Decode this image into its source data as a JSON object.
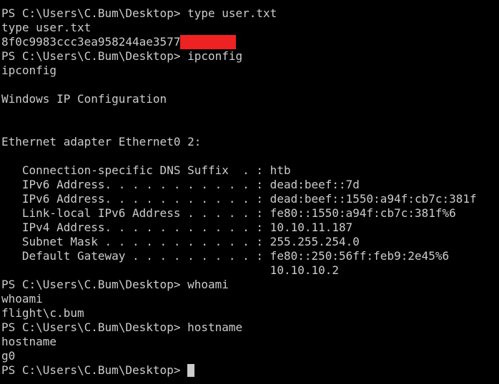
{
  "terminal": {
    "text_color": "#cccccc",
    "background_color": "#000000",
    "redaction_color": "#ee2222",
    "lines": [
      "PS C:\\Users\\C.Bum\\Desktop> type user.txt",
      "type user.txt",
      "8f0c9983ccc3ea958244ae3577",
      "PS C:\\Users\\C.Bum\\Desktop> ipconfig",
      "ipconfig",
      "",
      "Windows IP Configuration",
      "",
      "",
      "Ethernet adapter Ethernet0 2:",
      "",
      "   Connection-specific DNS Suffix  . : htb",
      "   IPv6 Address. . . . . . . . . . . : dead:beef::7d",
      "   IPv6 Address. . . . . . . . . . . : dead:beef::1550:a94f:cb7c:381f",
      "   Link-local IPv6 Address . . . . . : fe80::1550:a94f:cb7c:381f%6",
      "   IPv4 Address. . . . . . . . . . . : 10.10.11.187",
      "   Subnet Mask . . . . . . . . . . . : 255.255.254.0",
      "   Default Gateway . . . . . . . . . : fe80::250:56ff:feb9:2e45%6",
      "                                       10.10.10.2",
      "PS C:\\Users\\C.Bum\\Desktop> whoami",
      "whoami",
      "flight\\c.bum",
      "PS C:\\Users\\C.Bum\\Desktop> hostname",
      "hostname",
      "g0",
      "PS C:\\Users\\C.Bum\\Desktop> "
    ]
  }
}
